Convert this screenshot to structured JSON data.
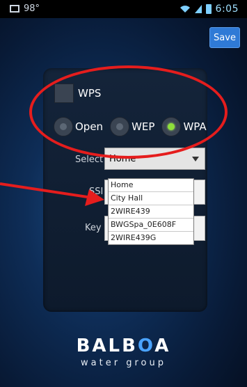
{
  "status_bar": {
    "left_text": "98°",
    "time": "6:05",
    "icons": [
      "photo-icon",
      "sd-card-icon",
      "wifi-icon",
      "signal-icon",
      "battery-icon"
    ]
  },
  "toolbar": {
    "save_label": "Save"
  },
  "wps": {
    "label": "WPS",
    "checked": false
  },
  "security": {
    "options": [
      {
        "label": "Open",
        "selected": false
      },
      {
        "label": "WEP",
        "selected": false
      },
      {
        "label": "WPA",
        "selected": true
      }
    ]
  },
  "select": {
    "label": "Select",
    "value": "Home",
    "options": [
      "Home",
      "City Hall",
      "2WIRE439",
      "BWGSpa_0E608F",
      "2WIRE439G"
    ]
  },
  "ssid": {
    "label": "SSI",
    "value": ""
  },
  "key": {
    "label": "Key",
    "value": ""
  },
  "brand": {
    "logo": "BALB",
    "logo_glyph": "O",
    "logo_tail": "A",
    "tagline": "water group"
  },
  "colors": {
    "accent": "#2f7ad6",
    "annotation": "#e51d1d",
    "selected_radio": "#8ee03a"
  }
}
